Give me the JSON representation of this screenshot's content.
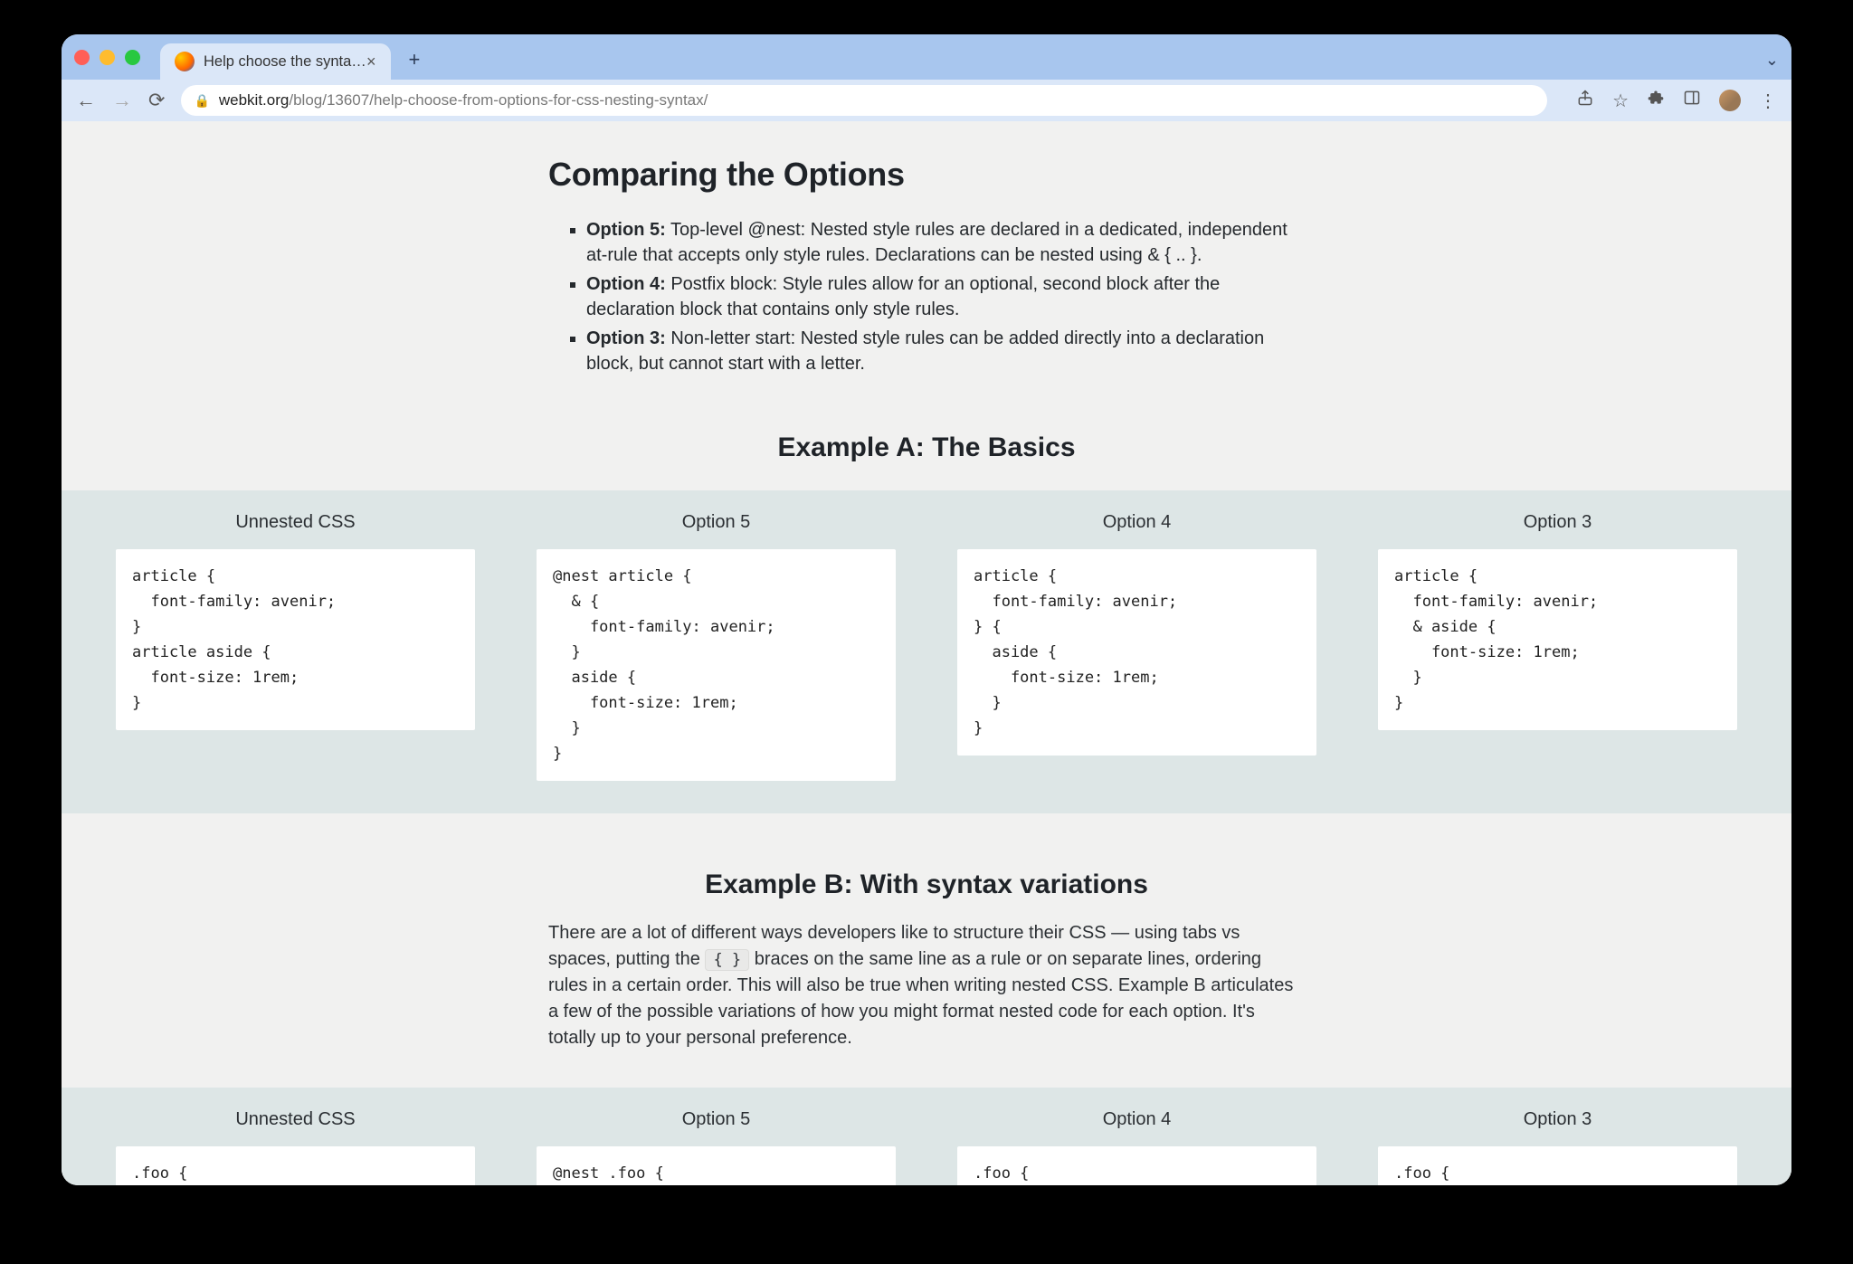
{
  "browser": {
    "tab_title": "Help choose the syntax for CSS",
    "url_host": "webkit.org",
    "url_path": "/blog/13607/help-choose-from-options-for-css-nesting-syntax/"
  },
  "h2": "Comparing the Options",
  "options": [
    {
      "label": "Option 5:",
      "text": " Top-level @nest: Nested style rules are declared in a dedicated, independent at-rule that accepts only style rules. Declarations can be nested using & { .. }."
    },
    {
      "label": "Option 4:",
      "text": " Postfix block: Style rules allow for an optional, second block after the declaration block that contains only style rules."
    },
    {
      "label": "Option 3:",
      "text": " Non-letter start: Nested style rules can be added directly into a declaration block, but cannot start with a letter."
    }
  ],
  "exA": {
    "title": "Example A: The Basics",
    "cols": [
      "Unnested CSS",
      "Option 5",
      "Option 4",
      "Option 3"
    ],
    "code": [
      "article {\n  font-family: avenir;\n}\narticle aside {\n  font-size: 1rem;\n}",
      "@nest article {\n  & {\n    font-family: avenir;\n  }\n  aside {\n    font-size: 1rem;\n  }\n}",
      "article {\n  font-family: avenir;\n} {\n  aside {\n    font-size: 1rem;\n  }\n}",
      "article {\n  font-family: avenir;\n  & aside {\n    font-size: 1rem;\n  }\n}"
    ]
  },
  "exB": {
    "title": "Example B: With syntax variations",
    "para_before": "There are a lot of different ways developers like to structure their CSS — using tabs vs spaces, putting the ",
    "para_code": "{ }",
    "para_after": " braces on the same line as a rule or on separate lines, ordering rules in a certain order. This will also be true when writing nested CSS. Example B articulates a few of the possible variations of how you might format nested code for each option. It's totally up to your personal preference.",
    "cols": [
      "Unnested CSS",
      "Option 5",
      "Option 4",
      "Option 3"
    ],
    "code": [
      ".foo {",
      "@nest .foo {",
      ".foo {",
      ".foo {"
    ]
  }
}
